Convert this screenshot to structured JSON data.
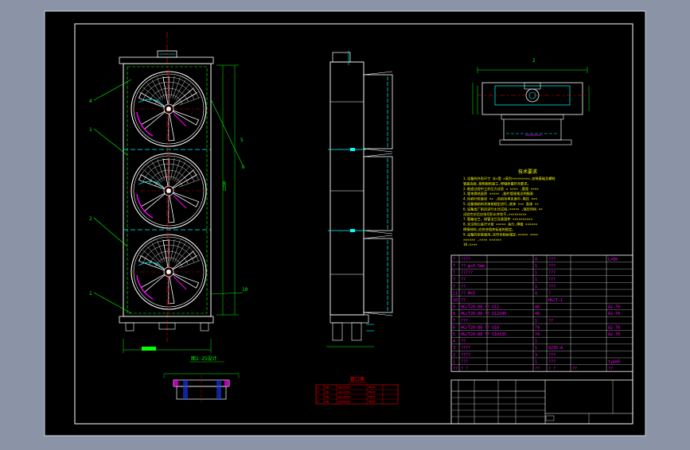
{
  "colors": {
    "window_bg": "#8a94a6",
    "paper": "#000000",
    "frame": "#ffffff",
    "green": "#00ff00",
    "cyan": "#00ffff",
    "magenta": "#ff00ff",
    "yellow": "#ffff00",
    "red": "#ff0000"
  },
  "front_view": {
    "leader_labels": [
      "4",
      "1",
      "2",
      "1"
    ],
    "side_labels": [
      "5",
      "6",
      "10"
    ]
  },
  "detail_caption": "图1-25设计",
  "top_view_label": "2",
  "notes": {
    "title": "技术要求",
    "lines": [
      "1.设备的外形尺寸 长×宽 ×高为×××××××××,安装基础及螺栓",
      "  管路连接,按照图纸施工,焊缝质量符合要求。",
      "2.制造过程中工作压力试验 = ×××× ,管程 ××××",
      "3.管束换热面积 ××××× ,翅片管规格见明细表",
      "4.风机叶轮直径 ×× ,风机功率见表中,电压 ×××",
      "5.设备钢结构涂漆按规定进行,底漆 ××× 面漆 ××",
      "6.设备出厂前应进行水压试验,××××× ,保压时间 ××",
      "  试验完毕后应排尽积水并吹干,×××××××××",
      "7.管箱法兰、接管法兰及紧固件 ××××××××××",
      "8.未注明公差尺寸按 ××××× 执行,焊缝 ××××××",
      "  焊接材料,应符合相关标准的规定。",
      "9.设备的安装使用,应符合相关规定,××××× ××××",
      "  ×××××× ,×××× ××××××",
      "10.××××"
    ]
  },
  "bom": {
    "rows": [
      [
        "7",
        "????",
        "4",
        "???",
        "",
        "L=8m"
      ],
      [
        "7",
        "?? φ×0.5mm",
        "1",
        "???",
        "",
        ""
      ],
      [
        "7",
        "?????",
        "1",
        "???",
        "",
        ""
      ],
      [
        "7",
        "??",
        "1",
        "???",
        "",
        ""
      ],
      [
        "7",
        "??",
        "1",
        "???",
        "",
        ""
      ],
      [
        "11",
        "?? M×5",
        "4",
        "?",
        "",
        ""
      ],
      [
        "10",
        "??",
        "",
        "HG/T-1",
        "",
        ""
      ],
      [
        "9",
        "HG/T20-88 ?? U12",
        "48",
        "",
        "",
        "A2-70"
      ],
      [
        "8",
        "HG/T20-88 ?? U12X40",
        "48",
        "",
        "",
        "A2-70"
      ],
      [
        "7",
        "???",
        "1",
        "??",
        "",
        ""
      ],
      [
        "6",
        "HG/T20-88 ?? U10",
        "74",
        "",
        "",
        "A2-70"
      ],
      [
        "5",
        "HG/T20-88 ?? U10X35",
        "74",
        "",
        "",
        "A2-70"
      ],
      [
        "4",
        "??",
        "1",
        "",
        "",
        ""
      ],
      [
        "3",
        "????",
        "1",
        "Q235-A",
        "",
        ""
      ],
      [
        "2",
        "????",
        "3",
        "???",
        "",
        ""
      ],
      [
        "1",
        "???",
        "1",
        "???",
        "",
        "type6"
      ],
      [
        "??",
        "? ?",
        "??",
        "? ?",
        "??",
        "??"
      ]
    ]
  },
  "nozzle_table": {
    "title": "管口表",
    "rows": [
      [
        "A",
        "DN",
        "HG20592",
        "PN16"
      ],
      [
        "B",
        "DN",
        "HG20592",
        "PN16"
      ],
      [
        "C",
        "DN",
        "HG20592",
        "PN16"
      ],
      [
        "D",
        "DN",
        "HG20592",
        "PN16"
      ]
    ]
  }
}
